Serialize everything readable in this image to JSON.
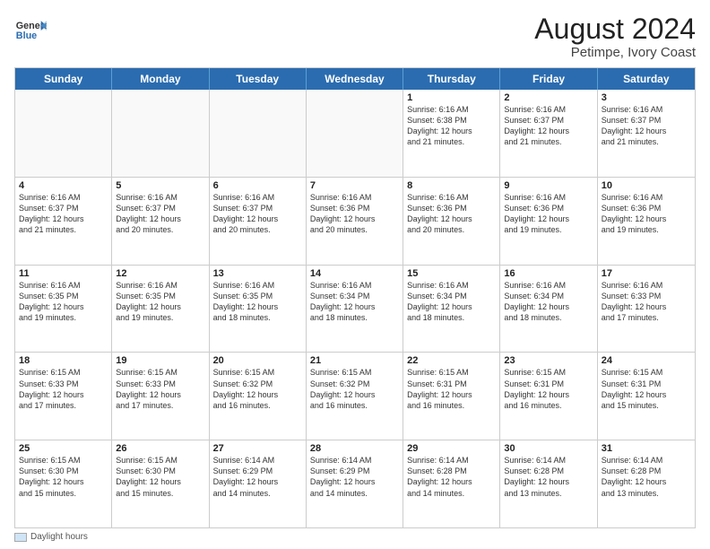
{
  "header": {
    "logo_general": "General",
    "logo_blue": "Blue",
    "month_year": "August 2024",
    "location": "Petimpe, Ivory Coast"
  },
  "days_of_week": [
    "Sunday",
    "Monday",
    "Tuesday",
    "Wednesday",
    "Thursday",
    "Friday",
    "Saturday"
  ],
  "footer_label": "Daylight hours",
  "weeks": [
    [
      {
        "day": "",
        "info": ""
      },
      {
        "day": "",
        "info": ""
      },
      {
        "day": "",
        "info": ""
      },
      {
        "day": "",
        "info": ""
      },
      {
        "day": "1",
        "info": "Sunrise: 6:16 AM\nSunset: 6:38 PM\nDaylight: 12 hours\nand 21 minutes."
      },
      {
        "day": "2",
        "info": "Sunrise: 6:16 AM\nSunset: 6:37 PM\nDaylight: 12 hours\nand 21 minutes."
      },
      {
        "day": "3",
        "info": "Sunrise: 6:16 AM\nSunset: 6:37 PM\nDaylight: 12 hours\nand 21 minutes."
      }
    ],
    [
      {
        "day": "4",
        "info": "Sunrise: 6:16 AM\nSunset: 6:37 PM\nDaylight: 12 hours\nand 21 minutes."
      },
      {
        "day": "5",
        "info": "Sunrise: 6:16 AM\nSunset: 6:37 PM\nDaylight: 12 hours\nand 20 minutes."
      },
      {
        "day": "6",
        "info": "Sunrise: 6:16 AM\nSunset: 6:37 PM\nDaylight: 12 hours\nand 20 minutes."
      },
      {
        "day": "7",
        "info": "Sunrise: 6:16 AM\nSunset: 6:36 PM\nDaylight: 12 hours\nand 20 minutes."
      },
      {
        "day": "8",
        "info": "Sunrise: 6:16 AM\nSunset: 6:36 PM\nDaylight: 12 hours\nand 20 minutes."
      },
      {
        "day": "9",
        "info": "Sunrise: 6:16 AM\nSunset: 6:36 PM\nDaylight: 12 hours\nand 19 minutes."
      },
      {
        "day": "10",
        "info": "Sunrise: 6:16 AM\nSunset: 6:36 PM\nDaylight: 12 hours\nand 19 minutes."
      }
    ],
    [
      {
        "day": "11",
        "info": "Sunrise: 6:16 AM\nSunset: 6:35 PM\nDaylight: 12 hours\nand 19 minutes."
      },
      {
        "day": "12",
        "info": "Sunrise: 6:16 AM\nSunset: 6:35 PM\nDaylight: 12 hours\nand 19 minutes."
      },
      {
        "day": "13",
        "info": "Sunrise: 6:16 AM\nSunset: 6:35 PM\nDaylight: 12 hours\nand 18 minutes."
      },
      {
        "day": "14",
        "info": "Sunrise: 6:16 AM\nSunset: 6:34 PM\nDaylight: 12 hours\nand 18 minutes."
      },
      {
        "day": "15",
        "info": "Sunrise: 6:16 AM\nSunset: 6:34 PM\nDaylight: 12 hours\nand 18 minutes."
      },
      {
        "day": "16",
        "info": "Sunrise: 6:16 AM\nSunset: 6:34 PM\nDaylight: 12 hours\nand 18 minutes."
      },
      {
        "day": "17",
        "info": "Sunrise: 6:16 AM\nSunset: 6:33 PM\nDaylight: 12 hours\nand 17 minutes."
      }
    ],
    [
      {
        "day": "18",
        "info": "Sunrise: 6:15 AM\nSunset: 6:33 PM\nDaylight: 12 hours\nand 17 minutes."
      },
      {
        "day": "19",
        "info": "Sunrise: 6:15 AM\nSunset: 6:33 PM\nDaylight: 12 hours\nand 17 minutes."
      },
      {
        "day": "20",
        "info": "Sunrise: 6:15 AM\nSunset: 6:32 PM\nDaylight: 12 hours\nand 16 minutes."
      },
      {
        "day": "21",
        "info": "Sunrise: 6:15 AM\nSunset: 6:32 PM\nDaylight: 12 hours\nand 16 minutes."
      },
      {
        "day": "22",
        "info": "Sunrise: 6:15 AM\nSunset: 6:31 PM\nDaylight: 12 hours\nand 16 minutes."
      },
      {
        "day": "23",
        "info": "Sunrise: 6:15 AM\nSunset: 6:31 PM\nDaylight: 12 hours\nand 16 minutes."
      },
      {
        "day": "24",
        "info": "Sunrise: 6:15 AM\nSunset: 6:31 PM\nDaylight: 12 hours\nand 15 minutes."
      }
    ],
    [
      {
        "day": "25",
        "info": "Sunrise: 6:15 AM\nSunset: 6:30 PM\nDaylight: 12 hours\nand 15 minutes."
      },
      {
        "day": "26",
        "info": "Sunrise: 6:15 AM\nSunset: 6:30 PM\nDaylight: 12 hours\nand 15 minutes."
      },
      {
        "day": "27",
        "info": "Sunrise: 6:14 AM\nSunset: 6:29 PM\nDaylight: 12 hours\nand 14 minutes."
      },
      {
        "day": "28",
        "info": "Sunrise: 6:14 AM\nSunset: 6:29 PM\nDaylight: 12 hours\nand 14 minutes."
      },
      {
        "day": "29",
        "info": "Sunrise: 6:14 AM\nSunset: 6:28 PM\nDaylight: 12 hours\nand 14 minutes."
      },
      {
        "day": "30",
        "info": "Sunrise: 6:14 AM\nSunset: 6:28 PM\nDaylight: 12 hours\nand 13 minutes."
      },
      {
        "day": "31",
        "info": "Sunrise: 6:14 AM\nSunset: 6:28 PM\nDaylight: 12 hours\nand 13 minutes."
      }
    ]
  ]
}
